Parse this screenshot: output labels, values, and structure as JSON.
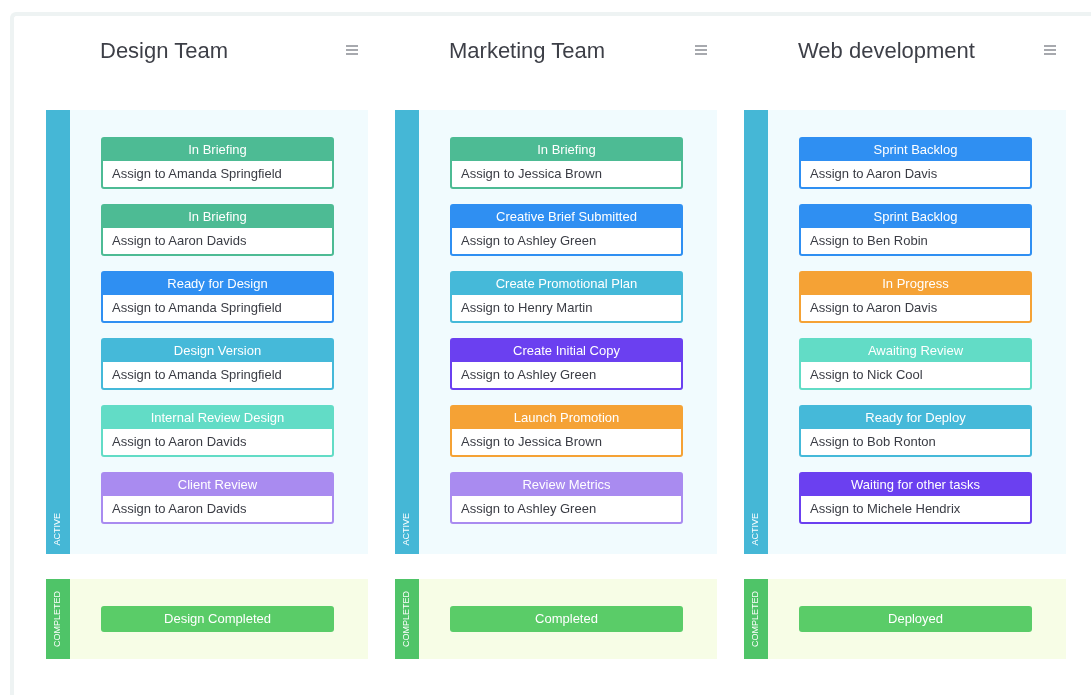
{
  "columns": [
    {
      "title": "Design Team",
      "active_label": "ACTIVE",
      "completed_label": "COMPLETED",
      "cards": [
        {
          "status": "In Briefing",
          "assignee": "Assign to Amanda Springfield",
          "color": "#4dbb94"
        },
        {
          "status": "In Briefing",
          "assignee": "Assign to Aaron Davids",
          "color": "#4dbb94"
        },
        {
          "status": "Ready for Design",
          "assignee": "Assign to Amanda Springfield",
          "color": "#2f8ff2"
        },
        {
          "status": "Design Version",
          "assignee": "Assign to Amanda Springfield",
          "color": "#45b9d9"
        },
        {
          "status": "Internal Review Design",
          "assignee": "Assign to Aaron Davids",
          "color": "#62dcc6"
        },
        {
          "status": "Client Review",
          "assignee": "Assign to Aaron Davids",
          "color": "#a98bf0"
        }
      ],
      "completed": {
        "status": "Design Completed",
        "color": "#5acc68"
      }
    },
    {
      "title": "Marketing Team",
      "active_label": "ACTIVE",
      "completed_label": "COMPLETED",
      "cards": [
        {
          "status": "In Briefing",
          "assignee": "Assign to Jessica Brown",
          "color": "#4dbb94"
        },
        {
          "status": "Creative Brief Submitted",
          "assignee": "Assign to Ashley Green",
          "color": "#2f8ff2"
        },
        {
          "status": "Create Promotional Plan",
          "assignee": "Assign to Henry Martin",
          "color": "#45b9d9"
        },
        {
          "status": "Create Initial Copy",
          "assignee": "Assign to Ashley Green",
          "color": "#6b40f0"
        },
        {
          "status": "Launch Promotion",
          "assignee": "Assign to Jessica Brown",
          "color": "#f5a235"
        },
        {
          "status": "Review Metrics",
          "assignee": "Assign to Ashley Green",
          "color": "#a98bf0"
        }
      ],
      "completed": {
        "status": "Completed",
        "color": "#5acc68"
      }
    },
    {
      "title": "Web development",
      "active_label": "ACTIVE",
      "completed_label": "COMPLETED",
      "cards": [
        {
          "status": "Sprint Backlog",
          "assignee": "Assign to Aaron Davis",
          "color": "#2f8ff2"
        },
        {
          "status": "Sprint Backlog",
          "assignee": "Assign to Ben Robin",
          "color": "#2f8ff2"
        },
        {
          "status": "In Progress",
          "assignee": "Assign to Aaron Davis",
          "color": "#f5a235"
        },
        {
          "status": "Awaiting Review",
          "assignee": "Assign to Nick Cool",
          "color": "#62dcc6"
        },
        {
          "status": "Ready for Deploy",
          "assignee": "Assign to Bob Ronton",
          "color": "#45b9d9"
        },
        {
          "status": "Waiting for other tasks",
          "assignee": "Assign to Michele Hendrix",
          "color": "#6b40f0"
        }
      ],
      "completed": {
        "status": "Deployed",
        "color": "#5acc68"
      }
    }
  ]
}
